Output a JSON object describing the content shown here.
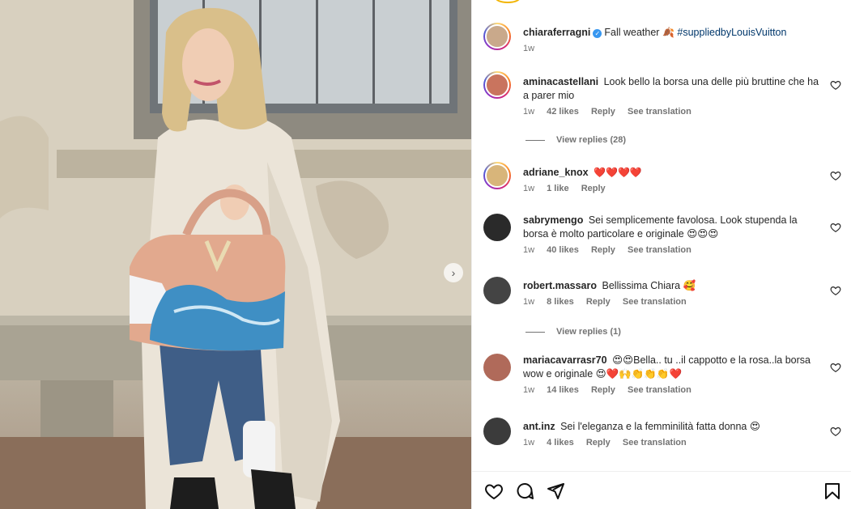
{
  "post": {
    "username": "chiaraferragni",
    "caption": "Fall weather",
    "caption_emoji": "🍂",
    "hashtag": "#suppliedbyLouisVuitton",
    "time": "1w"
  },
  "comments": [
    {
      "username": "aminacastellani",
      "text": "Look bello la borsa una delle più bruttine che ha a parer mio",
      "time": "1w",
      "likes": "42 likes",
      "reply": "Reply",
      "translation": "See translation",
      "avatar_color": "#c9745e",
      "story_ring": true
    },
    {
      "username": "adriane_knox",
      "text": "❤️❤️❤️❤️",
      "time": "1w",
      "likes": "1 like",
      "reply": "Reply",
      "translation": "",
      "avatar_color": "#d8b57a",
      "story_ring": true
    },
    {
      "username": "sabrymengo",
      "text": "Sei semplicemente favolosa. Look stupenda la borsa è molto particolare e originale 😍😍😍",
      "time": "1w",
      "likes": "40 likes",
      "reply": "Reply",
      "translation": "See translation",
      "avatar_color": "#2a2a2a",
      "story_ring": false
    },
    {
      "username": "robert.massaro",
      "text": "Bellissima Chiara 🥰",
      "time": "1w",
      "likes": "8 likes",
      "reply": "Reply",
      "translation": "See translation",
      "avatar_color": "#444",
      "story_ring": false
    },
    {
      "username": "mariacavarrasr70",
      "text": "😍😍Bella.. tu ..il cappotto e la rosa..la borsa wow e originale 😍❤️🙌👏👏👏❤️",
      "time": "1w",
      "likes": "14 likes",
      "reply": "Reply",
      "translation": "See translation",
      "avatar_color": "#b06a5a",
      "story_ring": false
    },
    {
      "username": "ant.inz",
      "text": "Sei l'eleganza e la femminilità fatta donna 😍",
      "time": "1w",
      "likes": "4 likes",
      "reply": "Reply",
      "translation": "See translation",
      "avatar_color": "#3b3b3b",
      "story_ring": false
    }
  ],
  "view_replies": [
    "View replies (28)",
    "View replies (1)"
  ],
  "icons": {
    "like": "heart-icon",
    "comment": "comment-icon",
    "share": "share-icon",
    "save": "bookmark-icon",
    "next": "chevron-right-icon"
  },
  "colors": {
    "hashtag": "#00376b",
    "meta": "#737373",
    "verified": "#3897f0"
  }
}
